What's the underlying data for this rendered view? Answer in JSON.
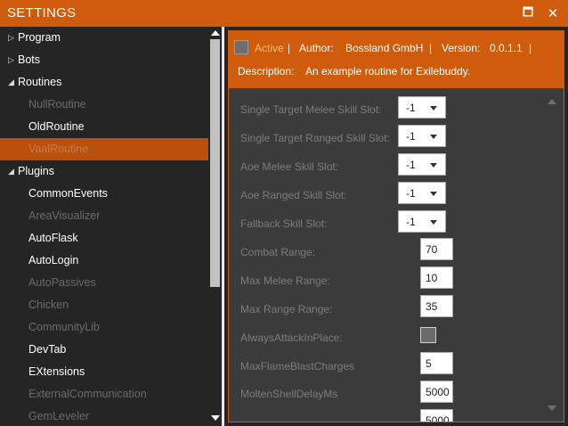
{
  "window": {
    "title": "SETTINGS",
    "maximize_icon": "🗖",
    "close_icon": "✕"
  },
  "tree": {
    "items": [
      {
        "label": "Program",
        "expander": "▷"
      },
      {
        "label": "Bots",
        "expander": "▷"
      },
      {
        "label": "Routines",
        "expander": "◢"
      },
      {
        "label": "NullRoutine"
      },
      {
        "label": "OldRoutine"
      },
      {
        "label": "VaalRoutine"
      },
      {
        "label": "Plugins",
        "expander": "◢"
      },
      {
        "label": "CommonEvents"
      },
      {
        "label": "AreaVisualizer"
      },
      {
        "label": "AutoFlask"
      },
      {
        "label": "AutoLogin"
      },
      {
        "label": "AutoPassives"
      },
      {
        "label": "Chicken"
      },
      {
        "label": "CommunityLib"
      },
      {
        "label": "DevTab"
      },
      {
        "label": "EXtensions"
      },
      {
        "label": "ExternalCommunication"
      },
      {
        "label": "GemLeveler"
      }
    ]
  },
  "header": {
    "active_label": "Active",
    "sep": "|",
    "author_label": "Author:",
    "author_value": "Bossland GmbH",
    "version_label": "Version:",
    "version_value": "0.0.1.1",
    "description_label": "Description:",
    "description_value": "An example routine for Exilebuddy."
  },
  "settings": {
    "dropdowns": [
      {
        "label": "Single Target Melee Skill Slot:",
        "value": "-1"
      },
      {
        "label": "Single Target Ranged Skill Slot:",
        "value": "-1"
      },
      {
        "label": "Aoe Melee Skill Slot:",
        "value": "-1"
      },
      {
        "label": "Aoe Ranged Skill Slot:",
        "value": "-1"
      },
      {
        "label": "Fallback Skill Slot:",
        "value": "-1"
      }
    ],
    "combat_range": {
      "label": "Combat Range:",
      "value": "70"
    },
    "max_melee_range": {
      "label": "Max Melee Range:",
      "value": "10"
    },
    "max_range_range": {
      "label": "Max Range Range:",
      "value": "35"
    },
    "always_attack": {
      "label": "AlwaysAttackInPlace:",
      "checked": false
    },
    "max_flame_blast": {
      "label": "MaxFlameBlastCharges",
      "value": "5"
    },
    "molten_shell": {
      "label": "MoltenShellDelayMs",
      "value": "5000"
    },
    "next_value": "5000"
  },
  "colors": {
    "accent": "#cf5b0c",
    "selected_row": "#b9510c",
    "panel_bg": "#3b3b3b"
  }
}
